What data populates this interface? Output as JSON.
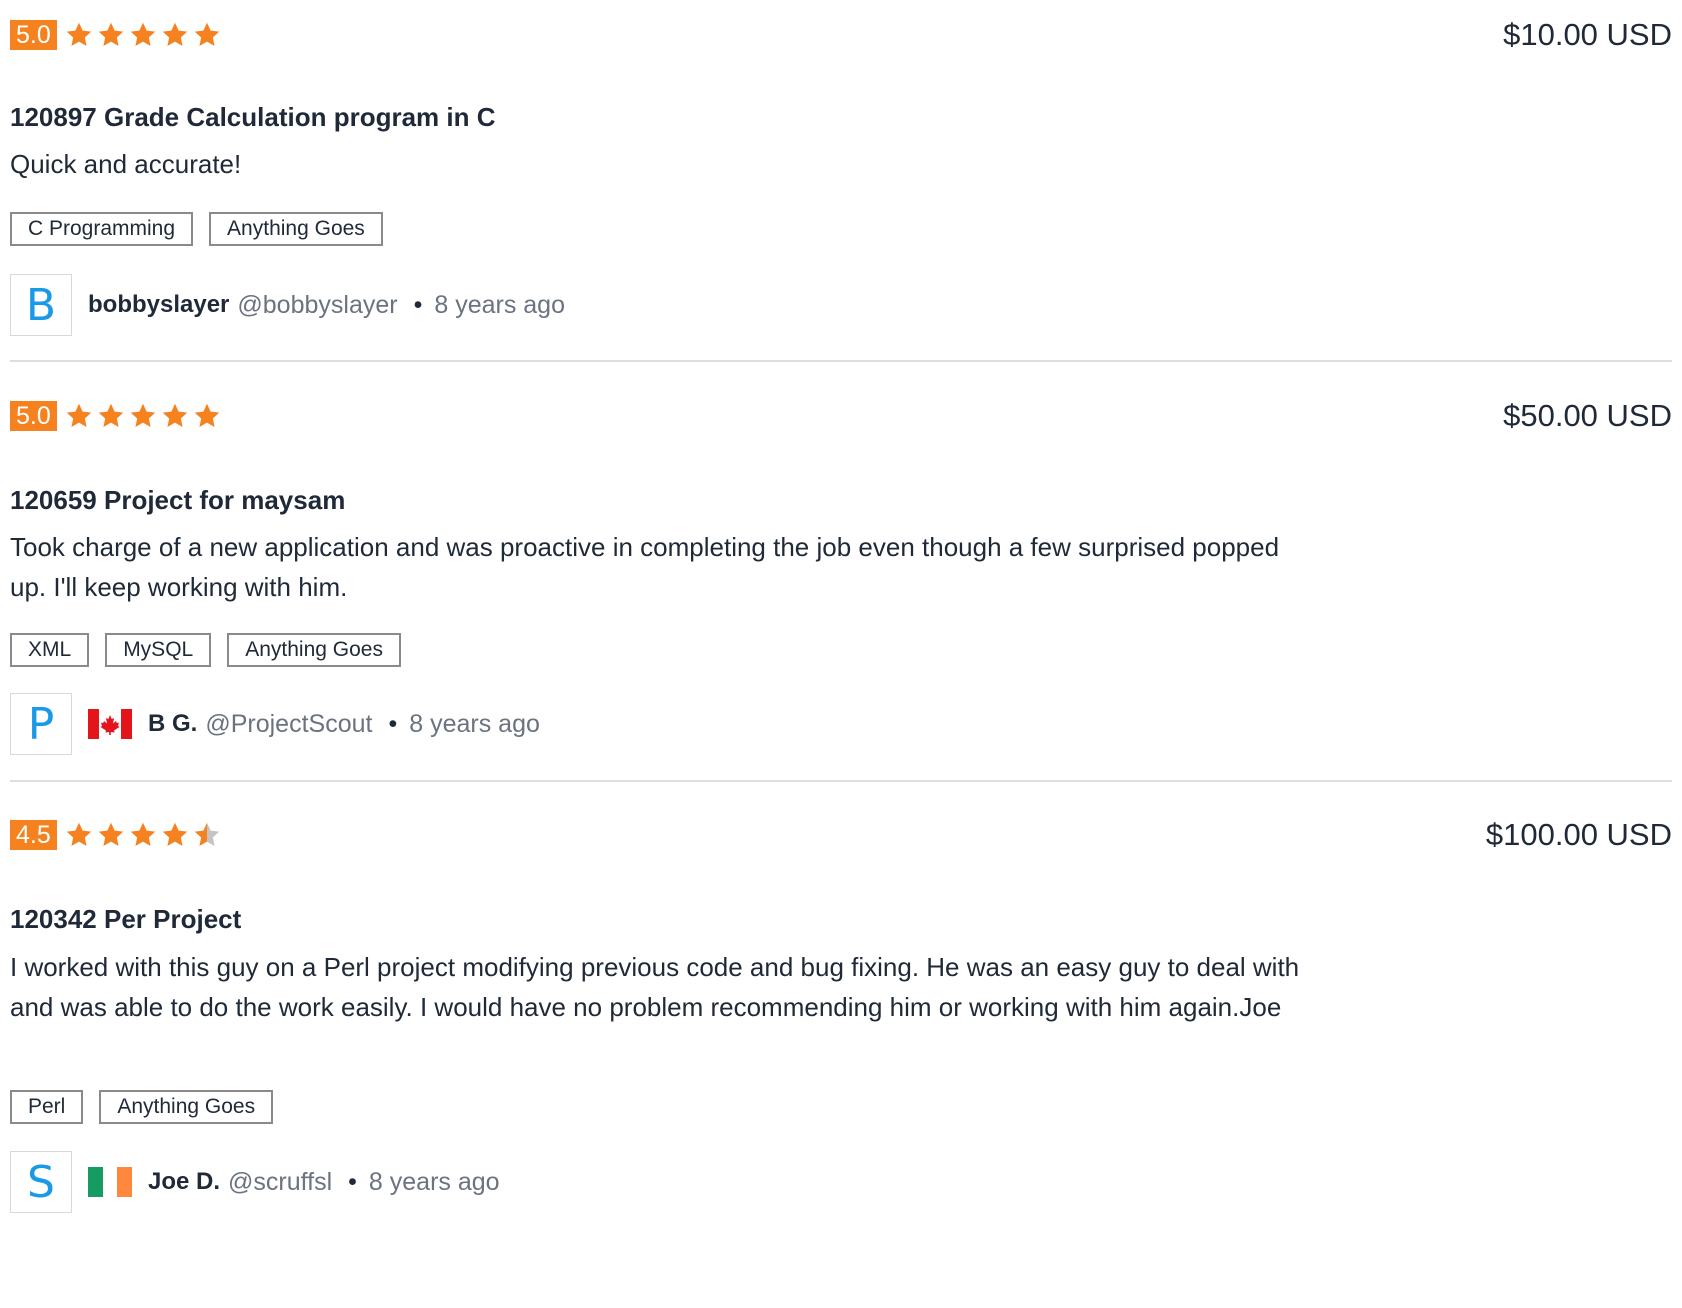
{
  "colors": {
    "accent": "#f5821f",
    "star_empty": "#c4c4c4",
    "avatar_letter": "#1a9ae6",
    "tag_border": "#8a8a8a",
    "divider": "#dedede"
  },
  "reviews": [
    {
      "rating": "5.0",
      "stars": 5,
      "amount": "$10.00 USD",
      "title": "120897 Grade Calculation program in C",
      "comment": "Quick and accurate!",
      "tags": [
        "C Programming",
        "Anything Goes"
      ],
      "user": {
        "avatar_letter": "B",
        "flag": "",
        "name": "bobbyslayer",
        "handle": "@bobbyslayer",
        "separator": "•",
        "time": "8 years ago"
      }
    },
    {
      "rating": "5.0",
      "stars": 5,
      "amount": "$50.00 USD",
      "title": "120659 Project for maysam",
      "comment": "Took charge of a new application and was proactive in completing the job even though a few surprised popped up. I'll keep working with him.",
      "tags": [
        "XML",
        "MySQL",
        "Anything Goes"
      ],
      "user": {
        "avatar_letter": "P",
        "flag": "canada-flag-icon",
        "name": "B G.",
        "handle": "@ProjectScout",
        "separator": "•",
        "time": "8 years ago"
      }
    },
    {
      "rating": "4.5",
      "stars": 4.5,
      "amount": "$100.00 USD",
      "title": "120342 Per Project",
      "comment": "I worked with this guy on a Perl project modifying previous code and bug fixing. He was an easy guy to deal with and was able to do the work easily. I would have no problem recommending him or working with him again.Joe",
      "tags": [
        "Perl",
        "Anything Goes"
      ],
      "user": {
        "avatar_letter": "S",
        "flag": "ireland-flag-icon",
        "name": "Joe D.",
        "handle": "@scruffsl",
        "separator": "•",
        "time": "8 years ago"
      }
    }
  ]
}
